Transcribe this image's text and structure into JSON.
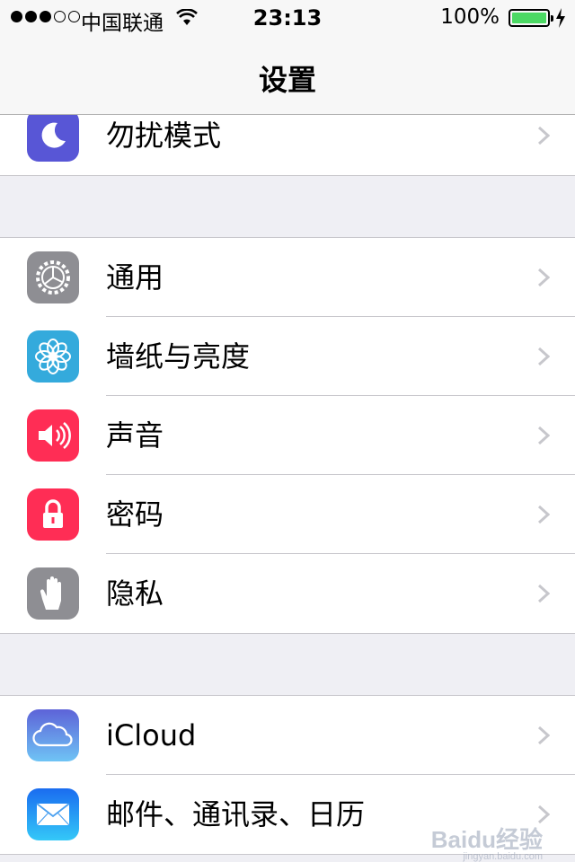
{
  "status_bar": {
    "signal_dots_filled": 3,
    "signal_dots_total": 5,
    "carrier": "中国联通",
    "time": "23:13",
    "battery_percent": "100%",
    "battery_level": 1.0,
    "battery_color": "#4cd964"
  },
  "nav": {
    "title": "设置"
  },
  "groups": [
    {
      "rows": [
        {
          "label": "勿扰模式",
          "icon": "moon-icon",
          "icon_color": "#5856d6"
        }
      ]
    },
    {
      "rows": [
        {
          "label": "通用",
          "icon": "gear-icon",
          "icon_color": "#8e8e93"
        },
        {
          "label": "墙纸与亮度",
          "icon": "flower-icon",
          "icon_color": "#34aadc"
        },
        {
          "label": "声音",
          "icon": "speaker-icon",
          "icon_color": "#ff2d55"
        },
        {
          "label": "密码",
          "icon": "lock-icon",
          "icon_color": "#ff2d55"
        },
        {
          "label": "隐私",
          "icon": "hand-icon",
          "icon_color": "#8e8e93"
        }
      ]
    },
    {
      "rows": [
        {
          "label": "iCloud",
          "icon": "cloud-icon",
          "icon_color": "#5ac8fa"
        },
        {
          "label": "邮件、通讯录、日历",
          "icon": "mail-icon",
          "icon_color": "#1d9bf6"
        }
      ]
    }
  ],
  "watermark": {
    "text": "Baidu经验",
    "sub": "jingyan.baidu.com"
  }
}
